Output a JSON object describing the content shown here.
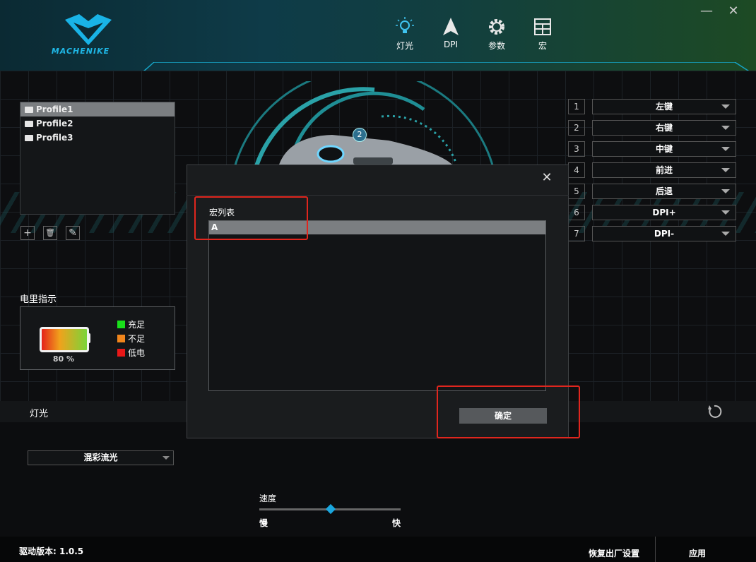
{
  "app": {
    "logo_text": "MACHENIKE"
  },
  "nav": [
    {
      "label": "灯光",
      "icon": "bulb-icon"
    },
    {
      "label": "DPI",
      "icon": "arrow-icon"
    },
    {
      "label": "参数",
      "icon": "gear-icon"
    },
    {
      "label": "宏",
      "icon": "grid-icon"
    }
  ],
  "window": {
    "minimize": "—",
    "close": "✕"
  },
  "profiles": [
    "Profile1",
    "Profile2",
    "Profile3"
  ],
  "profile_buttons": {
    "add": "+",
    "delete": "🗑",
    "edit": "✎"
  },
  "battery": {
    "title": "电里指示",
    "percent": "80 %",
    "level": 0.8,
    "legend": [
      {
        "label": "充足",
        "color": "#19e01b"
      },
      {
        "label": "不足",
        "color": "#f0851c"
      },
      {
        "label": "低电",
        "color": "#e81818"
      }
    ]
  },
  "mouse_badge": "2",
  "keys": [
    {
      "num": "1",
      "action": "左键"
    },
    {
      "num": "2",
      "action": "右键"
    },
    {
      "num": "3",
      "action": "中键"
    },
    {
      "num": "4",
      "action": "前进"
    },
    {
      "num": "5",
      "action": "后退"
    },
    {
      "num": "6",
      "action": "DPI+"
    },
    {
      "num": "7",
      "action": "DPI-"
    }
  ],
  "lighting": {
    "title": "灯光",
    "mode": "混彩流光",
    "speed_label": "速度",
    "slow": "慢",
    "fast": "快",
    "speed_level": 0.5
  },
  "footer": {
    "version": "驱动版本: 1.0.5",
    "restore": "恢复出厂设置",
    "apply": "应用"
  },
  "dialog": {
    "close": "✕",
    "list_label": "宏列表",
    "items": [
      "A"
    ],
    "ok": "确定"
  }
}
